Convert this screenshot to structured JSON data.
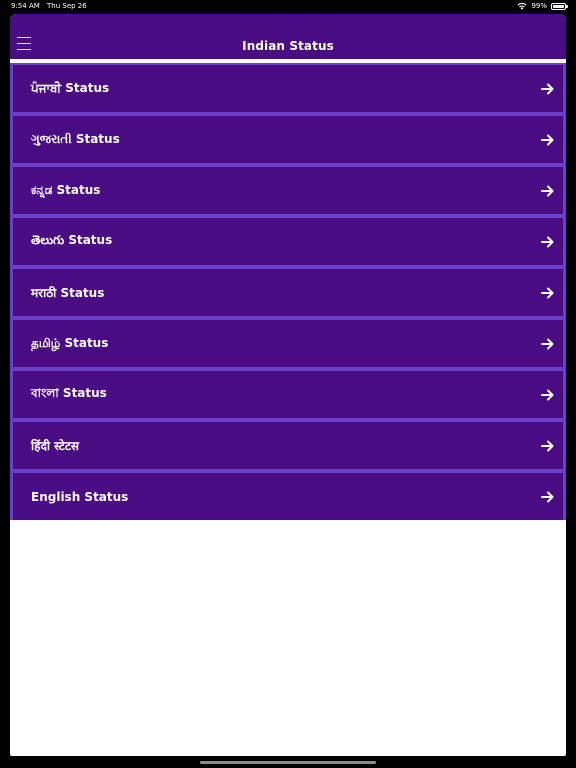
{
  "status_bar": {
    "time": "9:54 AM",
    "date": "Thu Sep 26",
    "battery": "99%",
    "battery_level": 0.99
  },
  "navbar": {
    "title": "Indian Status",
    "menu_icon": "hamburger-menu-icon",
    "background": "#490c82"
  },
  "list": {
    "arrow_icon": "arrow-right-icon",
    "item_background": "#490c82",
    "item_border": "#6a3fc9",
    "items": [
      {
        "label": "ਪੰਜਾਬੀ Status"
      },
      {
        "label": "ગુજરાતી Status"
      },
      {
        "label": "ಕನ್ನಡ Status"
      },
      {
        "label": "తెలుగు Status"
      },
      {
        "label": "मराठी Status"
      },
      {
        "label": "தமிழ் Status"
      },
      {
        "label": "বাংলা Status"
      },
      {
        "label": "हिंदी स्टेटस"
      },
      {
        "label": "English Status"
      }
    ]
  }
}
